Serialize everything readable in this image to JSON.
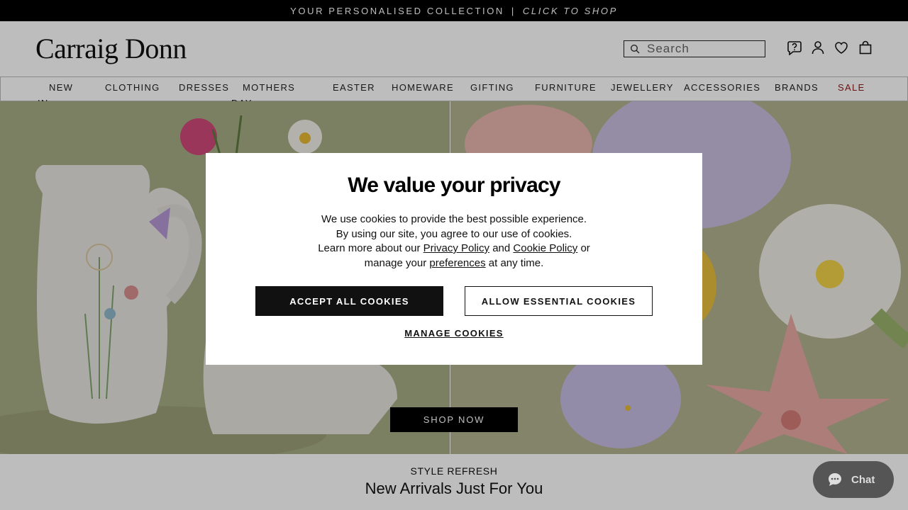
{
  "promo": {
    "text": "YOUR PERSONALISED COLLECTION",
    "separator": "|",
    "cta": "CLICK TO SHOP"
  },
  "header": {
    "logo": "Carraig Donn",
    "search_placeholder": "Search",
    "icons": [
      "help-icon",
      "account-icon",
      "wishlist-heart-icon",
      "bag-icon"
    ]
  },
  "nav": {
    "items": [
      {
        "line1": "NEW",
        "line2": "IN"
      },
      {
        "line1": "CLOTHING"
      },
      {
        "line1": "DRESSES"
      },
      {
        "line1": "MOTHERS",
        "line2": "DAY"
      },
      {
        "line1": "EASTER"
      },
      {
        "line1": "HOMEWARE"
      },
      {
        "line1": "GIFTING"
      },
      {
        "line1": "FURNITURE"
      },
      {
        "line1": "JEWELLERY"
      },
      {
        "line1": "ACCESSORIES"
      },
      {
        "line1": "BRANDS"
      },
      {
        "line1": "SALE"
      }
    ],
    "sale_color": "#8b1a1a"
  },
  "hero": {
    "button": "SHOP NOW"
  },
  "section": {
    "eyebrow": "STYLE REFRESH",
    "title": "New Arrivals Just For You"
  },
  "cookie_modal": {
    "title": "We value your privacy",
    "line1": "We use cookies to provide the best possible experience.",
    "line2": "By using our site, you agree to our use of cookies.",
    "line3_prefix": "Learn more about our",
    "privacy_link": "Privacy Policy",
    "and": "and",
    "cookie_link": "Cookie Policy",
    "or": "or",
    "line4_prefix": "manage your",
    "preferences_link": "preferences",
    "line4_suffix": "at any time.",
    "accept_button": "ACCEPT ALL COOKIES",
    "essential_button": "ALLOW ESSENTIAL COOKIES",
    "manage_link": "MANAGE COOKIES"
  },
  "chat": {
    "label": "Chat"
  }
}
